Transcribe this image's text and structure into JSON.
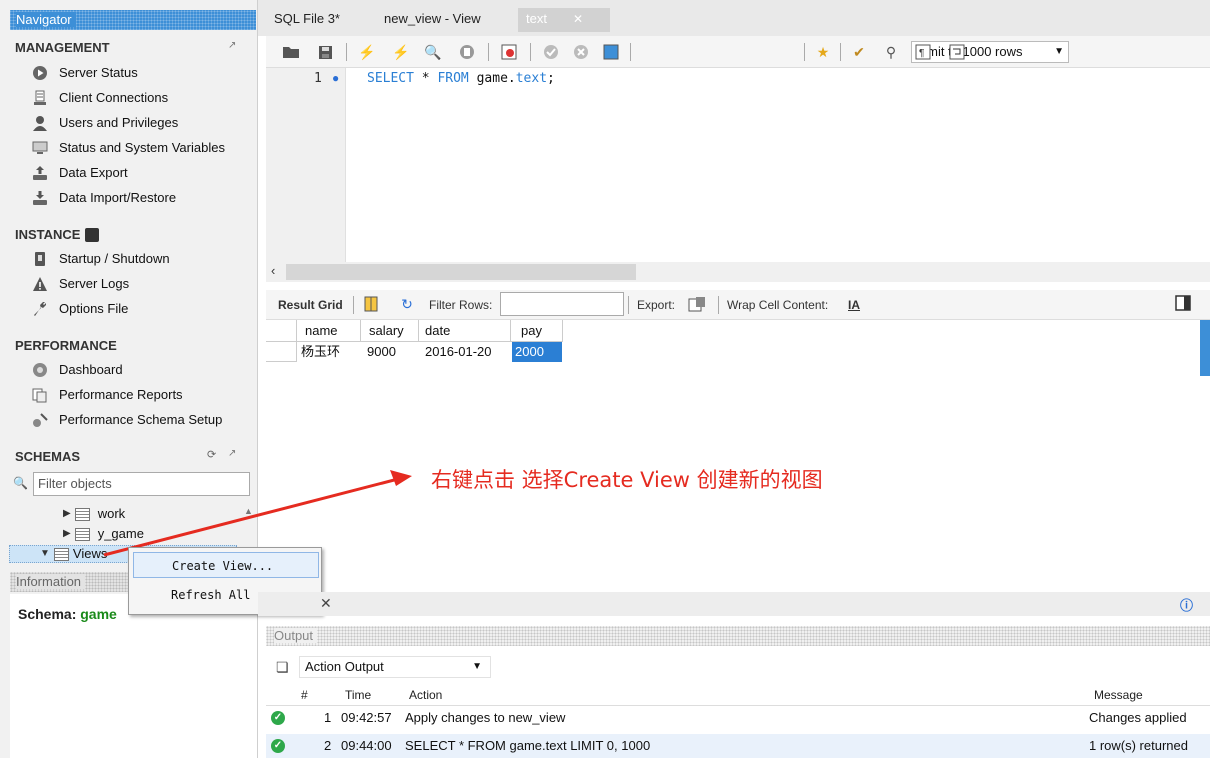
{
  "navigator": {
    "title": "Navigator",
    "management": {
      "title": "MANAGEMENT",
      "items": [
        "Server Status",
        "Client Connections",
        "Users and Privileges",
        "Status and System Variables",
        "Data Export",
        "Data Import/Restore"
      ]
    },
    "instance": {
      "title": "INSTANCE",
      "items": [
        "Startup / Shutdown",
        "Server Logs",
        "Options File"
      ]
    },
    "performance": {
      "title": "PERFORMANCE",
      "items": [
        "Dashboard",
        "Performance Reports",
        "Performance Schema Setup"
      ]
    },
    "schemas": {
      "title": "SCHEMAS",
      "filter_placeholder": "Filter objects",
      "tree": [
        "work",
        "y_game",
        "Views"
      ]
    },
    "information": {
      "title": "Information",
      "schema_label": "Schema:",
      "schema_value": "game"
    }
  },
  "context_menu": {
    "items": [
      "Create View...",
      "Refresh All"
    ]
  },
  "tabs": [
    "SQL File 3*",
    "new_view - View",
    "text"
  ],
  "toolbar": {
    "limit_label": "Limit to 1000 rows"
  },
  "editor": {
    "line_number": "1",
    "sql_keyword_select": "SELECT",
    "sql_star": " * ",
    "sql_keyword_from": "FROM",
    "sql_table_schema": " game.",
    "sql_table_name": "text",
    "sql_end": ";"
  },
  "result_toolbar": {
    "result_grid": "Result Grid",
    "filter_rows": "Filter Rows:",
    "export": "Export:",
    "wrap": "Wrap Cell Content:"
  },
  "grid": {
    "columns": [
      "name",
      "salary",
      "date",
      "pay"
    ],
    "rows": [
      [
        "杨玉环",
        "9000",
        "2016-01-20",
        "2000"
      ]
    ]
  },
  "annotation": "右键点击 选择Create View 创建新的视图",
  "output": {
    "title": "Output",
    "selector": "Action Output",
    "columns": [
      "#",
      "Time",
      "Action",
      "Message"
    ],
    "rows": [
      {
        "num": "1",
        "time": "09:42:57",
        "action": "Apply changes to new_view",
        "message": "Changes applied"
      },
      {
        "num": "2",
        "time": "09:44:00",
        "action": "SELECT * FROM game.text LIMIT 0, 1000",
        "message": "1 row(s) returned"
      }
    ]
  },
  "colors": {
    "accent": "#3d8fd7",
    "annotation": "#e52b20",
    "success": "#2ea84a"
  }
}
